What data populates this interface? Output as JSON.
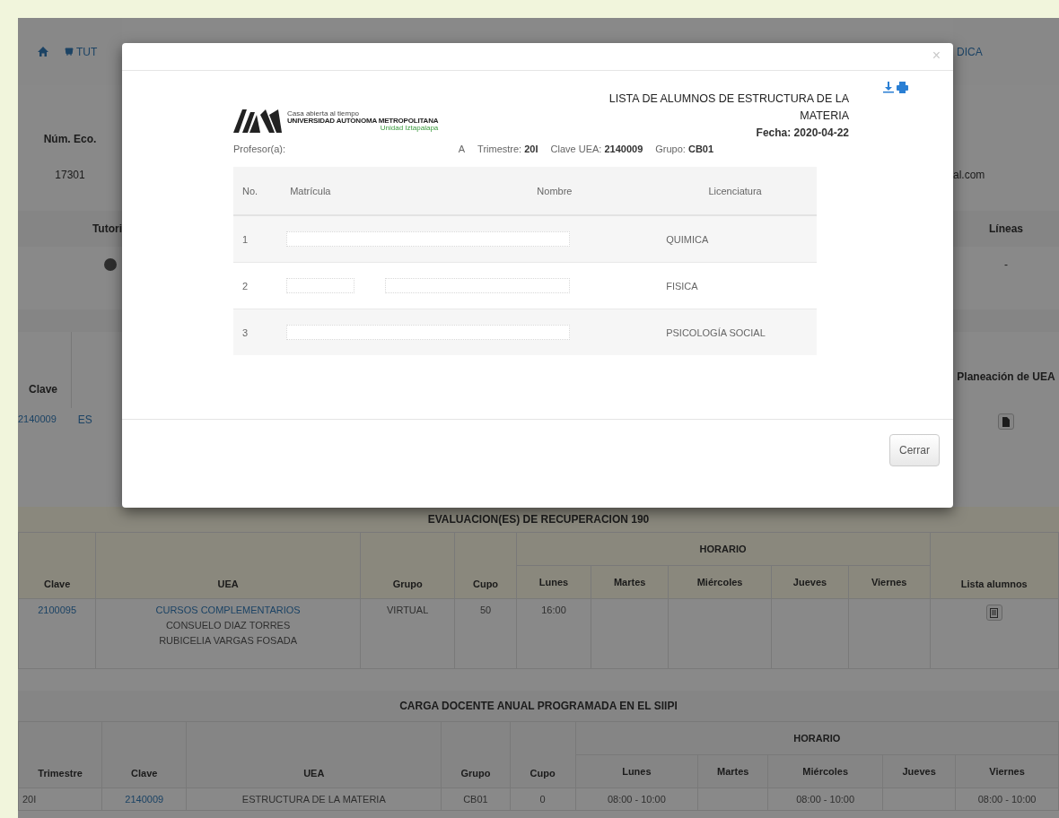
{
  "nav": {
    "items": [
      {
        "kind": "home"
      },
      {
        "kind": "link",
        "label": "TUT"
      }
    ],
    "right_label": "DICA"
  },
  "profile": {
    "id_header": "Núm. Eco.",
    "id_value": "17301",
    "email_tail": "al.com"
  },
  "tutoring": {
    "header": "Tutori",
    "right_header": "Líneas",
    "right_value": "-"
  },
  "course": {
    "header": "Clave",
    "right_header": "Planeación de UEA",
    "clave": "2140009",
    "uea": "ES"
  },
  "recovery": {
    "title": "EVALUACION(ES) DE RECUPERACION 190",
    "schedule_header": "HORARIO",
    "columns": [
      "Clave",
      "UEA",
      "Grupo",
      "Cupo",
      "Lunes",
      "Martes",
      "Miércoles",
      "Jueves",
      "Viernes",
      "Lista alumnos"
    ],
    "rows": [
      {
        "clave": "2100095",
        "uea": "CURSOS COMPLEMENTARIOS",
        "teachers": [
          "CONSUELO DIAZ TORRES",
          "RUBICELIA VARGAS FOSADA"
        ],
        "grupo": "VIRTUAL",
        "cupo": "50",
        "days": {
          "mon": "16:00"
        }
      }
    ]
  },
  "annual_load": {
    "title": "CARGA DOCENTE ANUAL PROGRAMADA EN EL SIIPI",
    "schedule_header": "HORARIO",
    "columns": [
      "Trimestre",
      "Clave",
      "UEA",
      "Grupo",
      "Cupo",
      "Lunes",
      "Martes",
      "Miércoles",
      "Jueves",
      "Viernes"
    ],
    "rows": [
      {
        "trimestre": "20I",
        "clave": "2140009",
        "uea": "ESTRUCTURA DE LA MATERIA",
        "grupo": "CB01",
        "cupo": "0",
        "days": {
          "mon": "08:00 - 10:00",
          "wed": "08:00 - 10:00",
          "fri": "08:00 - 10:00"
        }
      }
    ]
  },
  "modal": {
    "close": "×",
    "logo": {
      "tagline": "Casa abierta al tiempo",
      "name": "UNIVERSIDAD AUTONOMA METROPOLITANA",
      "unit": "Unidad Iztapalapa"
    },
    "title": "LISTA DE ALUMNOS DE ESTRUCTURA DE LA MATERIA",
    "date": "Fecha: 2020-04-22",
    "info": [
      {
        "label": "Profesor(a):",
        "value": "A",
        "kind": "name"
      },
      {
        "label": "Trimestre:",
        "value": "20I",
        "kind": "field"
      },
      {
        "label": "Clave UEA:",
        "value": "2140009",
        "kind": "field"
      },
      {
        "label": "Grupo:",
        "value": "CB01",
        "kind": "field"
      }
    ],
    "columns": [
      "No.",
      "Matrícula",
      "Nombre",
      "Licenciatura"
    ],
    "students": [
      {
        "no": "1",
        "licenciatura": "QUIMICA",
        "kind": "single"
      },
      {
        "no": "2",
        "licenciatura": "FISICA",
        "kind": "split"
      },
      {
        "no": "3",
        "licenciatura": "PSICOLOGÍA SOCIAL",
        "kind": "single"
      }
    ],
    "footer_button": "Cerrar"
  }
}
